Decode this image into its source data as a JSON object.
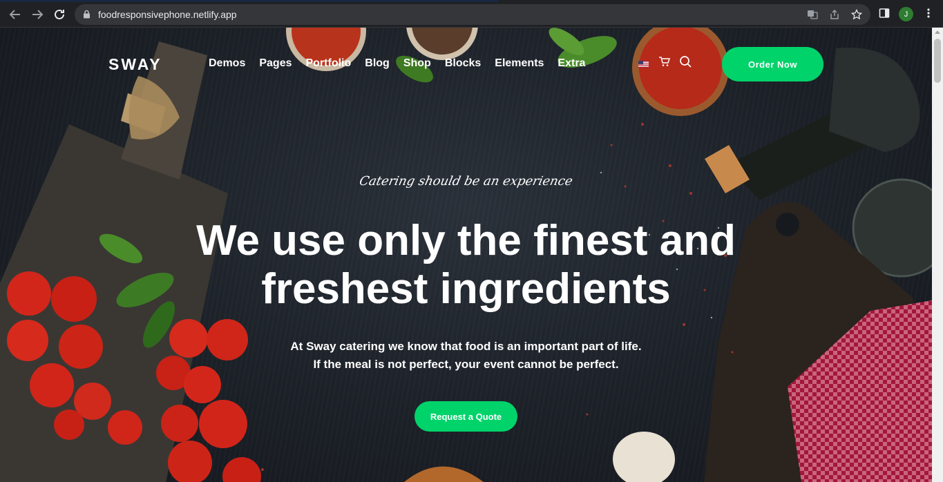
{
  "browser": {
    "url": "foodresponsivephone.netlify.app",
    "profile_initial": "J"
  },
  "header": {
    "logo": "SWAY",
    "nav": [
      "Demos",
      "Pages",
      "Portfolio",
      "Blog",
      "Shop",
      "Blocks",
      "Elements",
      "Extra"
    ],
    "order_button": "Order Now"
  },
  "hero": {
    "tagline": "Catering should be an experience",
    "headline_line1": "We use only the finest and",
    "headline_line2": "freshest ingredients",
    "sub_line1": "At Sway catering we know that food is an important part of life.",
    "sub_line2": "If the meal is not perfect, your event cannot be perfect.",
    "quote_button": "Request a Quote"
  },
  "colors": {
    "accent": "#00d36a",
    "background": "#1f2329"
  }
}
